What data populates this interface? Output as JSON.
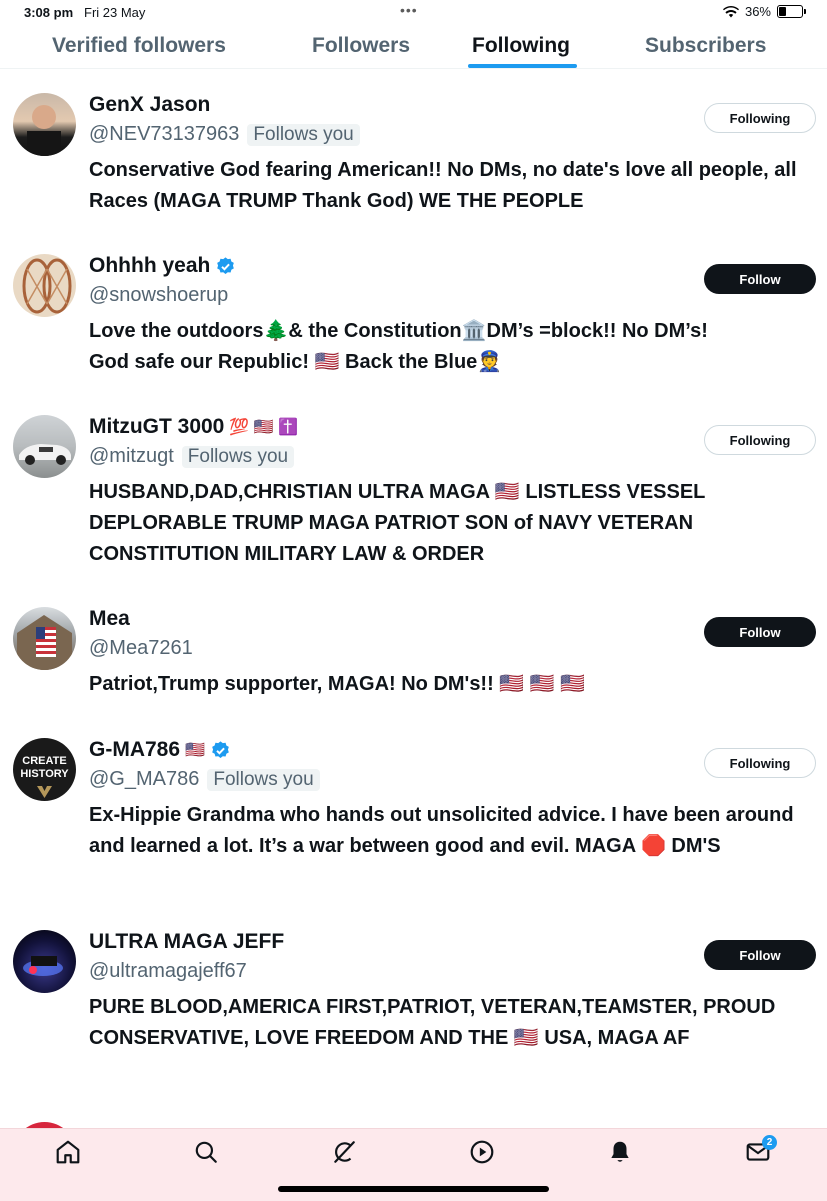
{
  "status_bar": {
    "time": "3:08 pm",
    "date": "Fri 23 May",
    "battery": "36%",
    "battery_level": 0.36
  },
  "tabs": [
    "Verified followers",
    "Followers",
    "Following",
    "Subscribers"
  ],
  "active_tab": "Following",
  "users": [
    {
      "name": "GenX Jason",
      "handle": "@NEV73137963",
      "follows_you": "Follows you",
      "button": "Following",
      "bio": "Conservative God fearing American!! No DMs, no date's love all people, all Races (MAGA TRUMP Thank God) WE THE PEOPLE"
    },
    {
      "name": "Ohhhh yeah",
      "handle": "@snowshoerup",
      "button": "Follow",
      "bio_line1": "Love the outdoors🌲& the Constitution🏛️DM’s =block!! No DM’s!",
      "bio_line2": "God safe our Republic! 🇺🇸 Back the Blue👮"
    },
    {
      "name": "MitzuGT 3000",
      "name_emojis": "💯 🇺🇸 ✝️",
      "handle": "@mitzugt",
      "follows_you": "Follows you",
      "button": "Following",
      "bio": "HUSBAND,DAD,CHRISTIAN ULTRA MAGA 🇺🇸 LISTLESS VESSEL DEPLORABLE TRUMP MAGA PATRIOT SON of NAVY VETERAN CONSTITUTION MILITARY LAW & ORDER"
    },
    {
      "name": "Mea",
      "handle": "@Mea7261",
      "button": "Follow",
      "bio": "Patriot,Trump supporter, MAGA! No DM's!! 🇺🇸 🇺🇸 🇺🇸"
    },
    {
      "name": "G-MA786",
      "name_emojis": "🇺🇸",
      "handle": "@G_MA786",
      "follows_you": "Follows you",
      "button": "Following",
      "avatar_text_1": "CREATE",
      "avatar_text_2": "HISTORY",
      "bio": "Ex-Hippie Grandma who hands out unsolicited advice. I have been around and learned a lot. It’s a war between good and evil. MAGA 🛑 DM'S"
    },
    {
      "name": "ULTRA MAGA JEFF",
      "handle": "@ultramagajeff67",
      "button": "Follow",
      "bio": "PURE BLOOD,AMERICA FIRST,PATRIOT, VETERAN,TEAMSTER, PROUD CONSERVATIVE, LOVE FREEDOM AND THE 🇺🇸 USA, MAGA AF"
    }
  ],
  "icons": [
    "home-icon",
    "search-icon",
    "grok-icon",
    "play-icon",
    "bell-icon",
    "mail-icon"
  ],
  "nav": {
    "messages_badge": "2"
  },
  "colors": {
    "accent": "#1d9bf0",
    "text": "#0f1419",
    "muted": "#536471",
    "nav_bg": "#fde9ec"
  }
}
